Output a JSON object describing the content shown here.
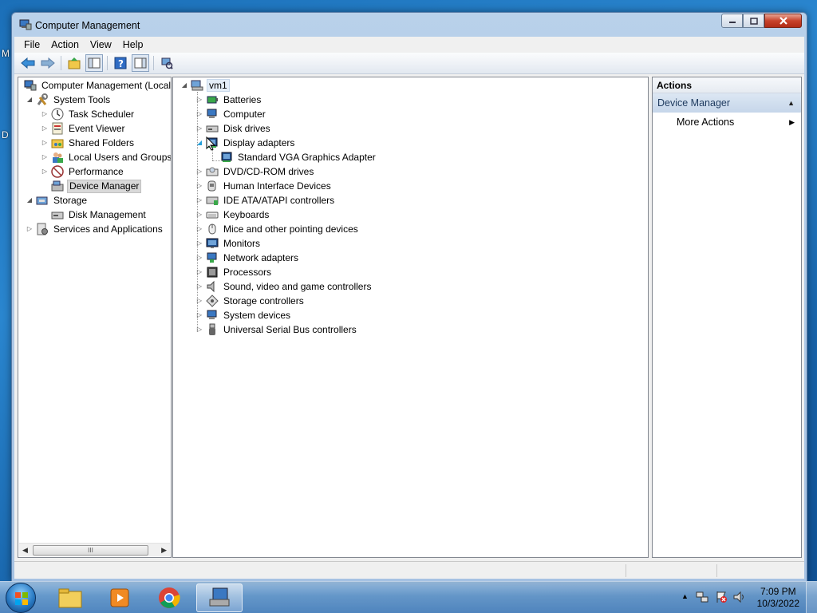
{
  "desktop": {
    "left_labels": [
      "M",
      "D"
    ]
  },
  "window": {
    "title": "Computer Management",
    "menu": [
      "File",
      "Action",
      "View",
      "Help"
    ]
  },
  "left_tree": {
    "items": [
      {
        "label": "Computer Management (Local",
        "icon": "computer-management-icon"
      },
      {
        "label": "System Tools",
        "icon": "tools-icon"
      },
      {
        "label": "Task Scheduler",
        "icon": "clock-icon"
      },
      {
        "label": "Event Viewer",
        "icon": "event-viewer-icon"
      },
      {
        "label": "Shared Folders",
        "icon": "shared-folder-icon"
      },
      {
        "label": "Local Users and Groups",
        "icon": "users-icon"
      },
      {
        "label": "Performance",
        "icon": "performance-icon"
      },
      {
        "label": "Device Manager",
        "icon": "device-manager-icon"
      },
      {
        "label": "Storage",
        "icon": "storage-icon"
      },
      {
        "label": "Disk Management",
        "icon": "disk-management-icon"
      },
      {
        "label": "Services and Applications",
        "icon": "services-icon"
      }
    ],
    "scrollbar_grip": "III"
  },
  "device_tree": {
    "root": "vm1",
    "categories": [
      {
        "label": "Batteries",
        "icon": "battery-icon"
      },
      {
        "label": "Computer",
        "icon": "computer-icon"
      },
      {
        "label": "Disk drives",
        "icon": "disk-drive-icon"
      },
      {
        "label": "Display adapters",
        "icon": "display-adapter-icon"
      },
      {
        "label": "Standard VGA Graphics Adapter",
        "icon": "vga-adapter-icon"
      },
      {
        "label": "DVD/CD-ROM drives",
        "icon": "dvd-icon"
      },
      {
        "label": "Human Interface Devices",
        "icon": "hid-icon"
      },
      {
        "label": "IDE ATA/ATAPI controllers",
        "icon": "ide-icon"
      },
      {
        "label": "Keyboards",
        "icon": "keyboard-icon"
      },
      {
        "label": "Mice and other pointing devices",
        "icon": "mouse-icon"
      },
      {
        "label": "Monitors",
        "icon": "monitor-icon"
      },
      {
        "label": "Network adapters",
        "icon": "network-adapter-icon"
      },
      {
        "label": "Processors",
        "icon": "processor-icon"
      },
      {
        "label": "Sound, video and game controllers",
        "icon": "sound-icon"
      },
      {
        "label": "Storage controllers",
        "icon": "storage-controller-icon"
      },
      {
        "label": "System devices",
        "icon": "system-devices-icon"
      },
      {
        "label": "Universal Serial Bus controllers",
        "icon": "usb-icon"
      }
    ]
  },
  "actions": {
    "header": "Actions",
    "section": "Device Manager",
    "more_actions": "More Actions"
  },
  "taskbar": {
    "clock_time": "7:09 PM",
    "clock_date": "10/3/2022"
  }
}
